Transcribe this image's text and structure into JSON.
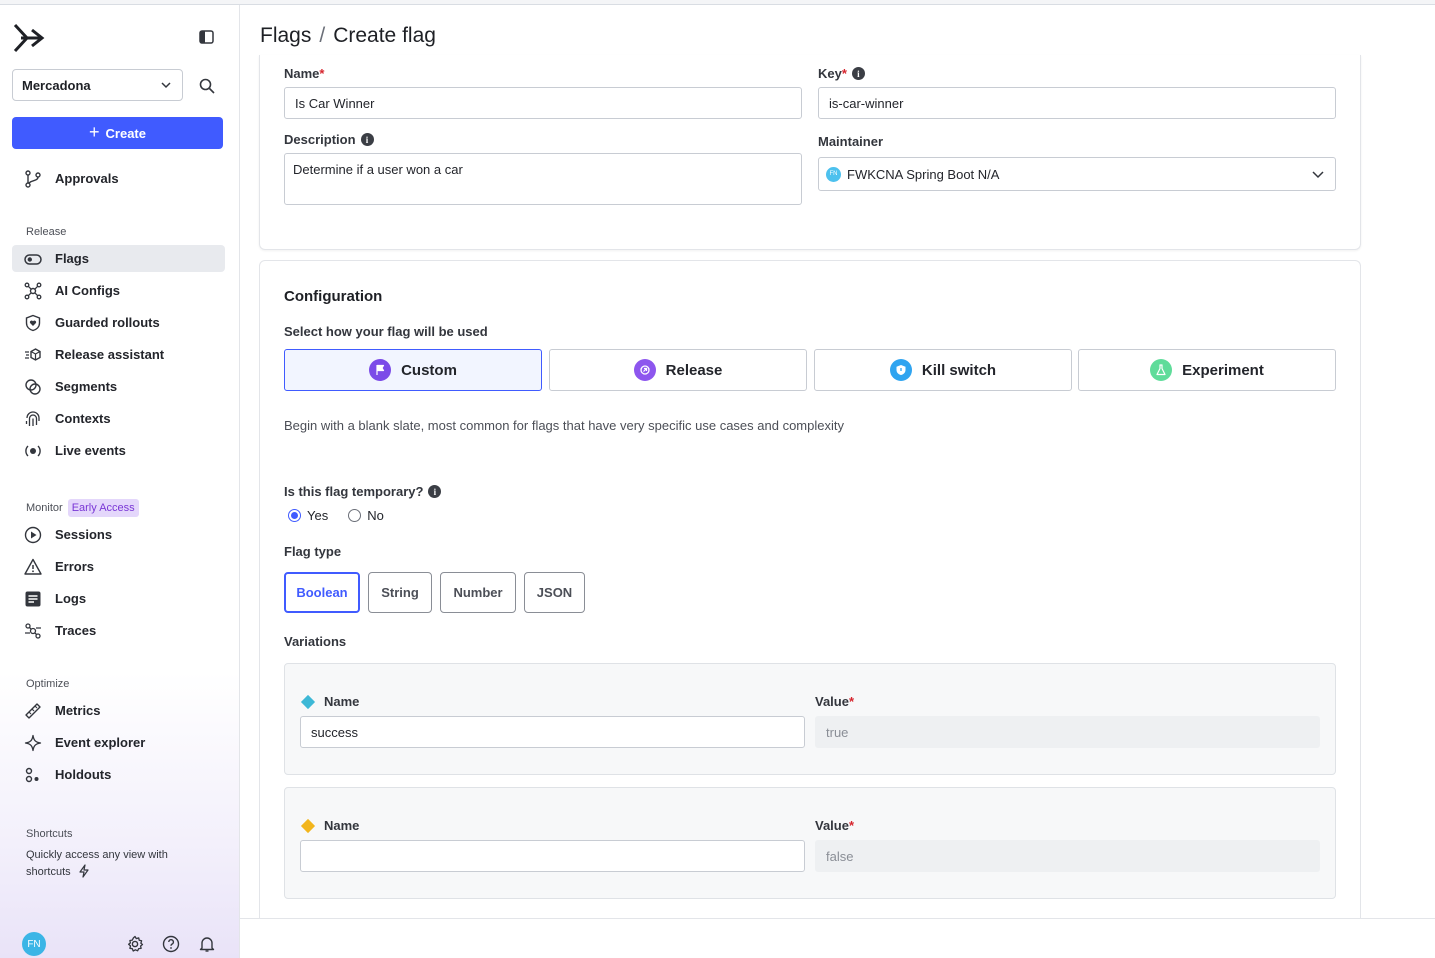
{
  "project": "Mercadona",
  "create_label": "Create",
  "nav_top": {
    "approvals": "Approvals"
  },
  "sections": {
    "release": "Release",
    "monitor": "Monitor",
    "monitor_badge": "Early Access",
    "optimize": "Optimize"
  },
  "release_items": [
    "Flags",
    "AI Configs",
    "Guarded rollouts",
    "Release assistant",
    "Segments",
    "Contexts",
    "Live events"
  ],
  "monitor_items": [
    "Sessions",
    "Errors",
    "Logs",
    "Traces"
  ],
  "optimize_items": [
    "Metrics",
    "Event explorer",
    "Holdouts"
  ],
  "shortcuts": {
    "title": "Shortcuts",
    "text": "Quickly access any view with shortcuts"
  },
  "user_initials": "FN",
  "breadcrumb": {
    "parent": "Flags",
    "separator": "/",
    "current": "Create flag"
  },
  "form": {
    "name_label": "Name",
    "name_value": "Is Car Winner",
    "key_label": "Key",
    "key_value": "is-car-winner",
    "description_label": "Description",
    "description_value": "Determine if a user won a car",
    "maintainer_label": "Maintainer",
    "maintainer_initials": "FN",
    "maintainer_value": "FWKCNA Spring Boot N/A",
    "required_mark": "*",
    "info_glyph": "i"
  },
  "configuration": {
    "title": "Configuration",
    "subtitle": "Select how your flag will be used",
    "types": [
      "Custom",
      "Release",
      "Kill switch",
      "Experiment"
    ],
    "selected_type": "Custom",
    "description": "Begin with a blank slate, most common for flags that have very specific use cases and complexity",
    "temporary_label": "Is this flag temporary?",
    "temporary_options": [
      "Yes",
      "No"
    ],
    "temporary_selected": "Yes",
    "flag_type_label": "Flag type",
    "flag_types": [
      "Boolean",
      "String",
      "Number",
      "JSON"
    ],
    "flag_type_selected": "Boolean",
    "variations_label": "Variations",
    "variations": [
      {
        "name_label": "Name",
        "name_value": "success",
        "value_label": "Value",
        "value": "true",
        "color": "#3db8d6"
      },
      {
        "name_label": "Name",
        "name_value": "",
        "value_label": "Value",
        "value": "false",
        "color": "#f2b51c"
      }
    ]
  },
  "colors": {
    "accent": "#405bff",
    "custom_icon": "#7b4be8",
    "release_icon": "#8d56ee",
    "kill_icon": "#2fa4f0",
    "experiment_icon": "#5fdc9a"
  }
}
